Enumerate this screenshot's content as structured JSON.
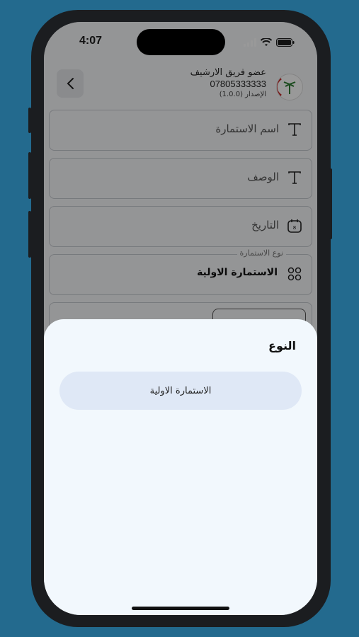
{
  "status_bar": {
    "time": "4:07"
  },
  "header": {
    "name": "عضو فريق الارشيف",
    "phone": "07805333333",
    "version": "الإصدار (1.0.0)"
  },
  "form": {
    "form_name_placeholder": "اسم الاستمارة",
    "description_placeholder": "الوصف",
    "date_placeholder": "التاريخ",
    "form_type_legend": "نوع الاستمارة",
    "form_type_value": "الاستمارة الاولية"
  },
  "sheet": {
    "title": "النوع",
    "options": [
      {
        "label": "الاستمارة الاولية"
      }
    ]
  },
  "colors": {
    "background": "#236a8e",
    "sheet": "#f2f8fd",
    "option": "#dfe8f6"
  }
}
